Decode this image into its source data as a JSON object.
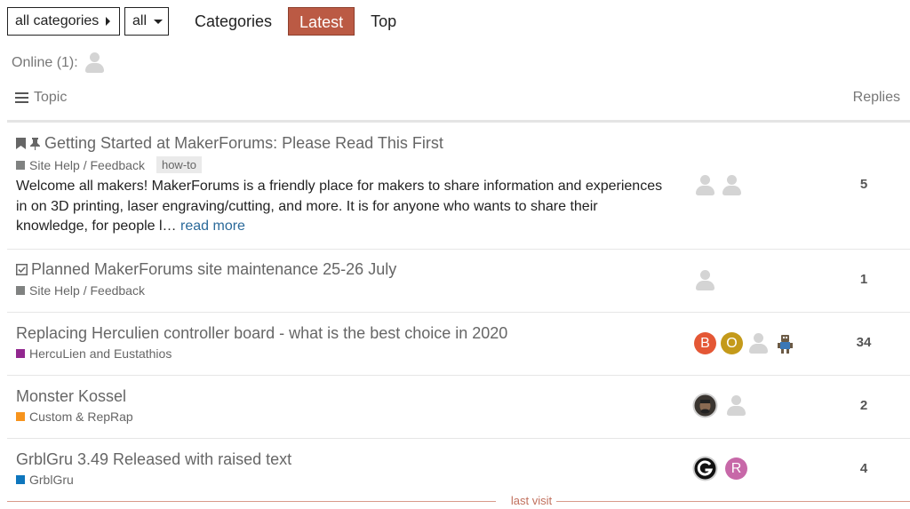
{
  "nav": {
    "category_dropdown": "all categories",
    "tag_dropdown": "all",
    "links": [
      "Categories",
      "Latest",
      "Top"
    ],
    "active": "Latest"
  },
  "online": {
    "label": "Online (1):"
  },
  "table": {
    "topic_header": "Topic",
    "replies_header": "Replies"
  },
  "colors": {
    "accent": "#bb5a44",
    "site_help": "#808281",
    "herculien": "#92278f",
    "custom_reprap": "#f7941d",
    "grblgru": "#0e76bd"
  },
  "topics": [
    {
      "title": "Getting Started at MakerForums: Please Read This First",
      "icons": [
        "bookmark-icon",
        "pin-icon"
      ],
      "category": "Site Help / Feedback",
      "tag": "how-to",
      "excerpt": "Welcome all makers! MakerForums is a friendly place for makers to share information and experiences in on 3D printing, laser engraving/cutting, and more. It is for anyone who wants to share their knowledge, for people l…",
      "read_more": "read more",
      "replies": "5",
      "posters": [
        "placeholder",
        "placeholder"
      ]
    },
    {
      "title": "Planned MakerForums site maintenance 25-26 July",
      "icons": [
        "checkbox-icon"
      ],
      "category": "Site Help / Feedback",
      "replies": "1",
      "posters": [
        "placeholder"
      ]
    },
    {
      "title": "Replacing Herculien controller board - what is the best choice in 2020",
      "category": "HercuLien and Eustathios",
      "replies": "34",
      "posters": [
        {
          "letter": "B",
          "color": "#e45735"
        },
        {
          "letter": "O",
          "color": "#c49a1a"
        },
        "placeholder",
        "robot"
      ]
    },
    {
      "title": "Monster Kossel",
      "category": "Custom & RepRap",
      "replies": "2",
      "posters": [
        "photo",
        "placeholder"
      ]
    },
    {
      "title": "GrblGru 3.49 Released with raised text",
      "category": "GrblGru",
      "replies": "4",
      "posters": [
        "logo",
        {
          "letter": "R",
          "color": "#c768a8"
        }
      ]
    }
  ],
  "last_visit": "last visit"
}
